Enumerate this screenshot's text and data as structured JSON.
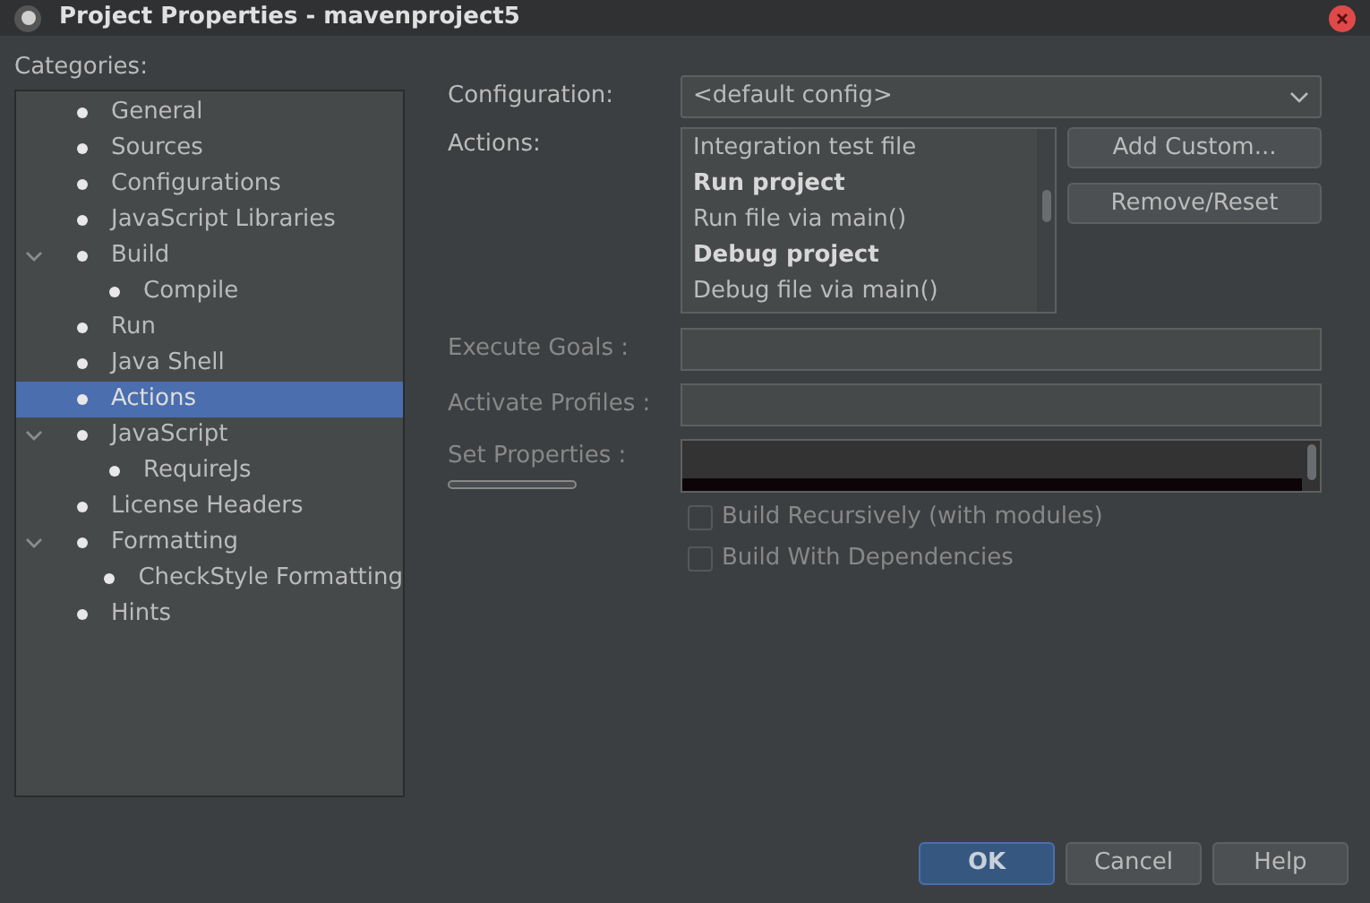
{
  "window": {
    "title": "Project Properties - mavenproject5"
  },
  "categories": {
    "label": "Categories:",
    "items": [
      {
        "label": "General",
        "selected": false
      },
      {
        "label": "Sources",
        "selected": false
      },
      {
        "label": "Configurations",
        "selected": false
      },
      {
        "label": "JavaScript Libraries",
        "selected": false
      },
      {
        "label": "Build",
        "selected": false,
        "expanded": true,
        "children": [
          {
            "label": "Compile",
            "selected": false
          }
        ]
      },
      {
        "label": "Run",
        "selected": false
      },
      {
        "label": "Java Shell",
        "selected": false
      },
      {
        "label": "Actions",
        "selected": true
      },
      {
        "label": "JavaScript",
        "selected": false,
        "expanded": true,
        "children": [
          {
            "label": "RequireJs",
            "selected": false
          }
        ]
      },
      {
        "label": "License Headers",
        "selected": false
      },
      {
        "label": "Formatting",
        "selected": false,
        "expanded": true,
        "children": [
          {
            "label": "CheckStyle Formatting",
            "selected": false
          }
        ]
      },
      {
        "label": "Hints",
        "selected": false
      }
    ]
  },
  "configuration": {
    "label": "Configuration:",
    "value": "<default config>"
  },
  "actions": {
    "label": "Actions:",
    "items": [
      {
        "label": "Integration test file",
        "bold": false
      },
      {
        "label": "Run project",
        "bold": true
      },
      {
        "label": "Run file via main()",
        "bold": false
      },
      {
        "label": "Debug project",
        "bold": true
      },
      {
        "label": "Debug file via main()",
        "bold": false
      }
    ],
    "buttons": [
      "Add Custom...",
      "Remove/Reset"
    ]
  },
  "fields": [
    {
      "label": "Execute Goals :",
      "disabled": true
    },
    {
      "label": "Activate Profiles :",
      "disabled": true
    }
  ],
  "set_properties": {
    "label": "Set Properties :",
    "disabled": true
  },
  "checkboxes": [
    {
      "label": "Build Recursively (with modules)",
      "checked": false,
      "disabled": true
    },
    {
      "label": "Build With Dependencies",
      "checked": false,
      "disabled": true
    }
  ],
  "footer_buttons": [
    {
      "label": "OK",
      "kind": "primary"
    },
    {
      "label": "Cancel",
      "kind": "normal"
    },
    {
      "label": "Help",
      "kind": "normal"
    }
  ]
}
